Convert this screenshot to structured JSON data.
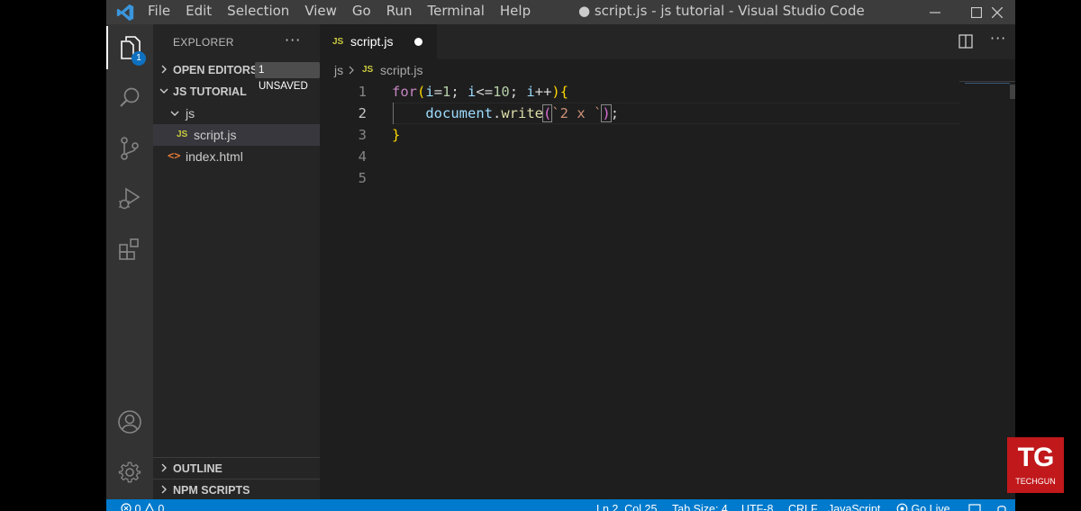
{
  "window": {
    "title": "● script.js - js tutorial - Visual Studio Code",
    "menu": [
      "File",
      "Edit",
      "Selection",
      "View",
      "Go",
      "Run",
      "Terminal",
      "Help"
    ]
  },
  "activity": {
    "explorer_badge": "1",
    "items": [
      "explorer-icon",
      "search-icon",
      "source-control-icon",
      "run-debug-icon",
      "extensions-icon",
      "account-icon",
      "settings-gear-icon"
    ]
  },
  "sidebar": {
    "title": "EXPLORER",
    "more": "···",
    "open_editors": {
      "label": "OPEN EDITORS",
      "badge": "1 UNSAVED"
    },
    "workspace": {
      "label": "JS TUTORIAL"
    },
    "tree": {
      "folder": "js",
      "file_selected": "script.js",
      "file_other": "index.html"
    },
    "outline": "OUTLINE",
    "npm_scripts": "NPM SCRIPTS",
    "js_icon": "JS",
    "html_icon": "<>"
  },
  "tab": {
    "label": "script.js",
    "icon": "JS"
  },
  "breadcrumb": {
    "folder": "js",
    "file": "script.js",
    "icon": "JS"
  },
  "editor": {
    "line_numbers": [
      "1",
      "2",
      "3",
      "4",
      "5"
    ],
    "current_line": 2
  },
  "statusbar": {
    "problems": "0",
    "warnings": "0",
    "position": "Ln 2, Col 25",
    "tab_size": "Tab Size: 4",
    "encoding": "UTF-8",
    "eol": "CRLF",
    "language": "JavaScript",
    "go_live": "Go Live"
  },
  "logo": {
    "main": "TG",
    "sub": "TECHGUN"
  },
  "colors": {
    "accent": "#007acc",
    "brand": "#c0181b"
  }
}
